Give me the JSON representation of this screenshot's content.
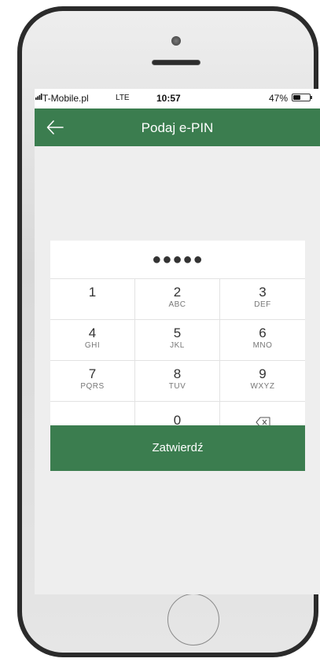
{
  "status_bar": {
    "carrier": "T-Mobile.pl",
    "network": "LTE",
    "time": "10:57",
    "battery_percent": "47%",
    "battery_level": 0.47
  },
  "header": {
    "title": "Podaj e-PIN",
    "back_icon": "arrow-left-icon"
  },
  "pin": {
    "masked_value": "●●●●●"
  },
  "keypad": {
    "keys": [
      {
        "num": "1",
        "letters": ""
      },
      {
        "num": "2",
        "letters": "ABC"
      },
      {
        "num": "3",
        "letters": "DEF"
      },
      {
        "num": "4",
        "letters": "GHI"
      },
      {
        "num": "5",
        "letters": "JKL"
      },
      {
        "num": "6",
        "letters": "MNO"
      },
      {
        "num": "7",
        "letters": "PQRS"
      },
      {
        "num": "8",
        "letters": "TUV"
      },
      {
        "num": "9",
        "letters": "WXYZ"
      },
      {
        "num": "",
        "letters": ""
      },
      {
        "num": "0",
        "letters": ""
      },
      {
        "num": "",
        "letters": "",
        "icon": "backspace-icon"
      }
    ]
  },
  "submit": {
    "label": "Zatwierdź"
  },
  "colors": {
    "accent": "#3b7d4f",
    "background": "#eeeeee"
  }
}
